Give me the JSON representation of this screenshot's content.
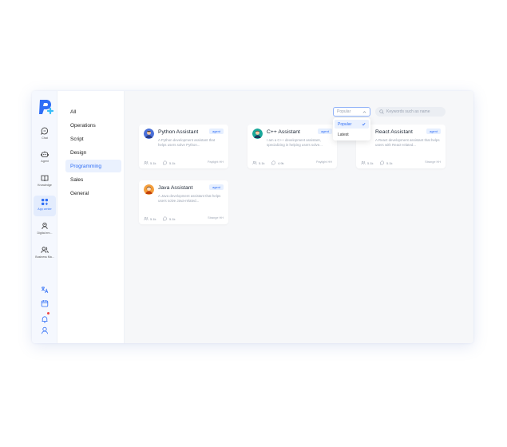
{
  "rail": {
    "items": [
      {
        "label": "Chat",
        "icon": "chat-icon"
      },
      {
        "label": "Agent",
        "icon": "robot-icon"
      },
      {
        "label": "Knowledge",
        "icon": "book-icon"
      },
      {
        "label": "App center",
        "icon": "apps-icon"
      },
      {
        "label": "Digital em...",
        "icon": "digital-employee-icon"
      },
      {
        "label": "Business Ma...",
        "icon": "users-icon"
      }
    ],
    "bottom_icons": [
      "translate-icon",
      "calendar-icon",
      "bell-icon",
      "user-icon"
    ]
  },
  "categories": [
    "All",
    "Operations",
    "Script",
    "Design",
    "Programming",
    "Sales",
    "General"
  ],
  "active_category": "Programming",
  "sort": {
    "current": "Popular",
    "options": [
      "Popular",
      "Latest"
    ]
  },
  "search": {
    "placeholder": "Keywords such as name"
  },
  "cards": [
    {
      "title": "Python Assistant",
      "badge": "agent",
      "desc": "A Python development assistant that helps users solve Python...",
      "users": "5.1k",
      "comments": "5.1k",
      "author": "Paylight HH"
    },
    {
      "title": "C++ Assistant",
      "badge": "agent",
      "desc": "I am a C++ development assistant, specializing in helping users solve...",
      "users": "5.1k",
      "comments": "4.9k",
      "author": "Paylight HH"
    },
    {
      "title": "React Assistant",
      "badge": "agent",
      "desc": "A React development assistant that helps users with React-related...",
      "users": "5.1k",
      "comments": "5.1k",
      "author": "Strange HH"
    },
    {
      "title": "Java Assistant",
      "badge": "agent",
      "desc": "A Java development assistant that helps users solve Java-related...",
      "users": "5.1k",
      "comments": "5.1k",
      "author": "Strange HH"
    }
  ],
  "colors": {
    "accent": "#2f6ef6",
    "badge_bg": "#e6efff",
    "notify": "#ef4444"
  }
}
